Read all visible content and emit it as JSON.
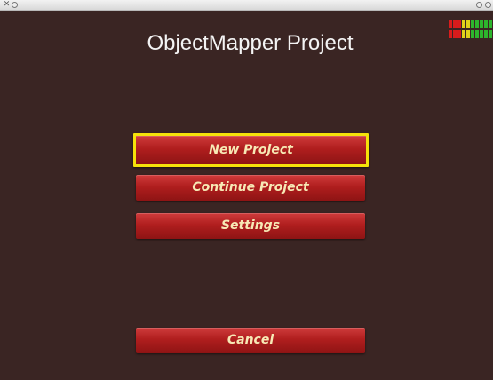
{
  "window": {
    "close_glyph": "✕",
    "title_controls_left": [
      "close-icon",
      "circle-icon"
    ],
    "title_controls_right": [
      "minimize-icon",
      "maximize-icon"
    ]
  },
  "app": {
    "title": "ObjectMapper Project"
  },
  "level_meter": {
    "icon": "level-meter-icon",
    "colors": [
      "#d81c1c",
      "#d81c1c",
      "#d81c1c",
      "#e0d21a",
      "#e0d21a",
      "#2db52d",
      "#2db52d",
      "#2db52d",
      "#2db52d",
      "#2db52d"
    ]
  },
  "menu": {
    "new_project": "New Project",
    "continue_project": "Continue Project",
    "settings": "Settings",
    "cancel": "Cancel",
    "selected": "New Project",
    "button_color": "#b01e1e",
    "label_color": "#f7e9b5",
    "highlight_color": "#f5e20a"
  },
  "colors": {
    "background": "#3a2523",
    "title_text": "#f4f4f4"
  }
}
